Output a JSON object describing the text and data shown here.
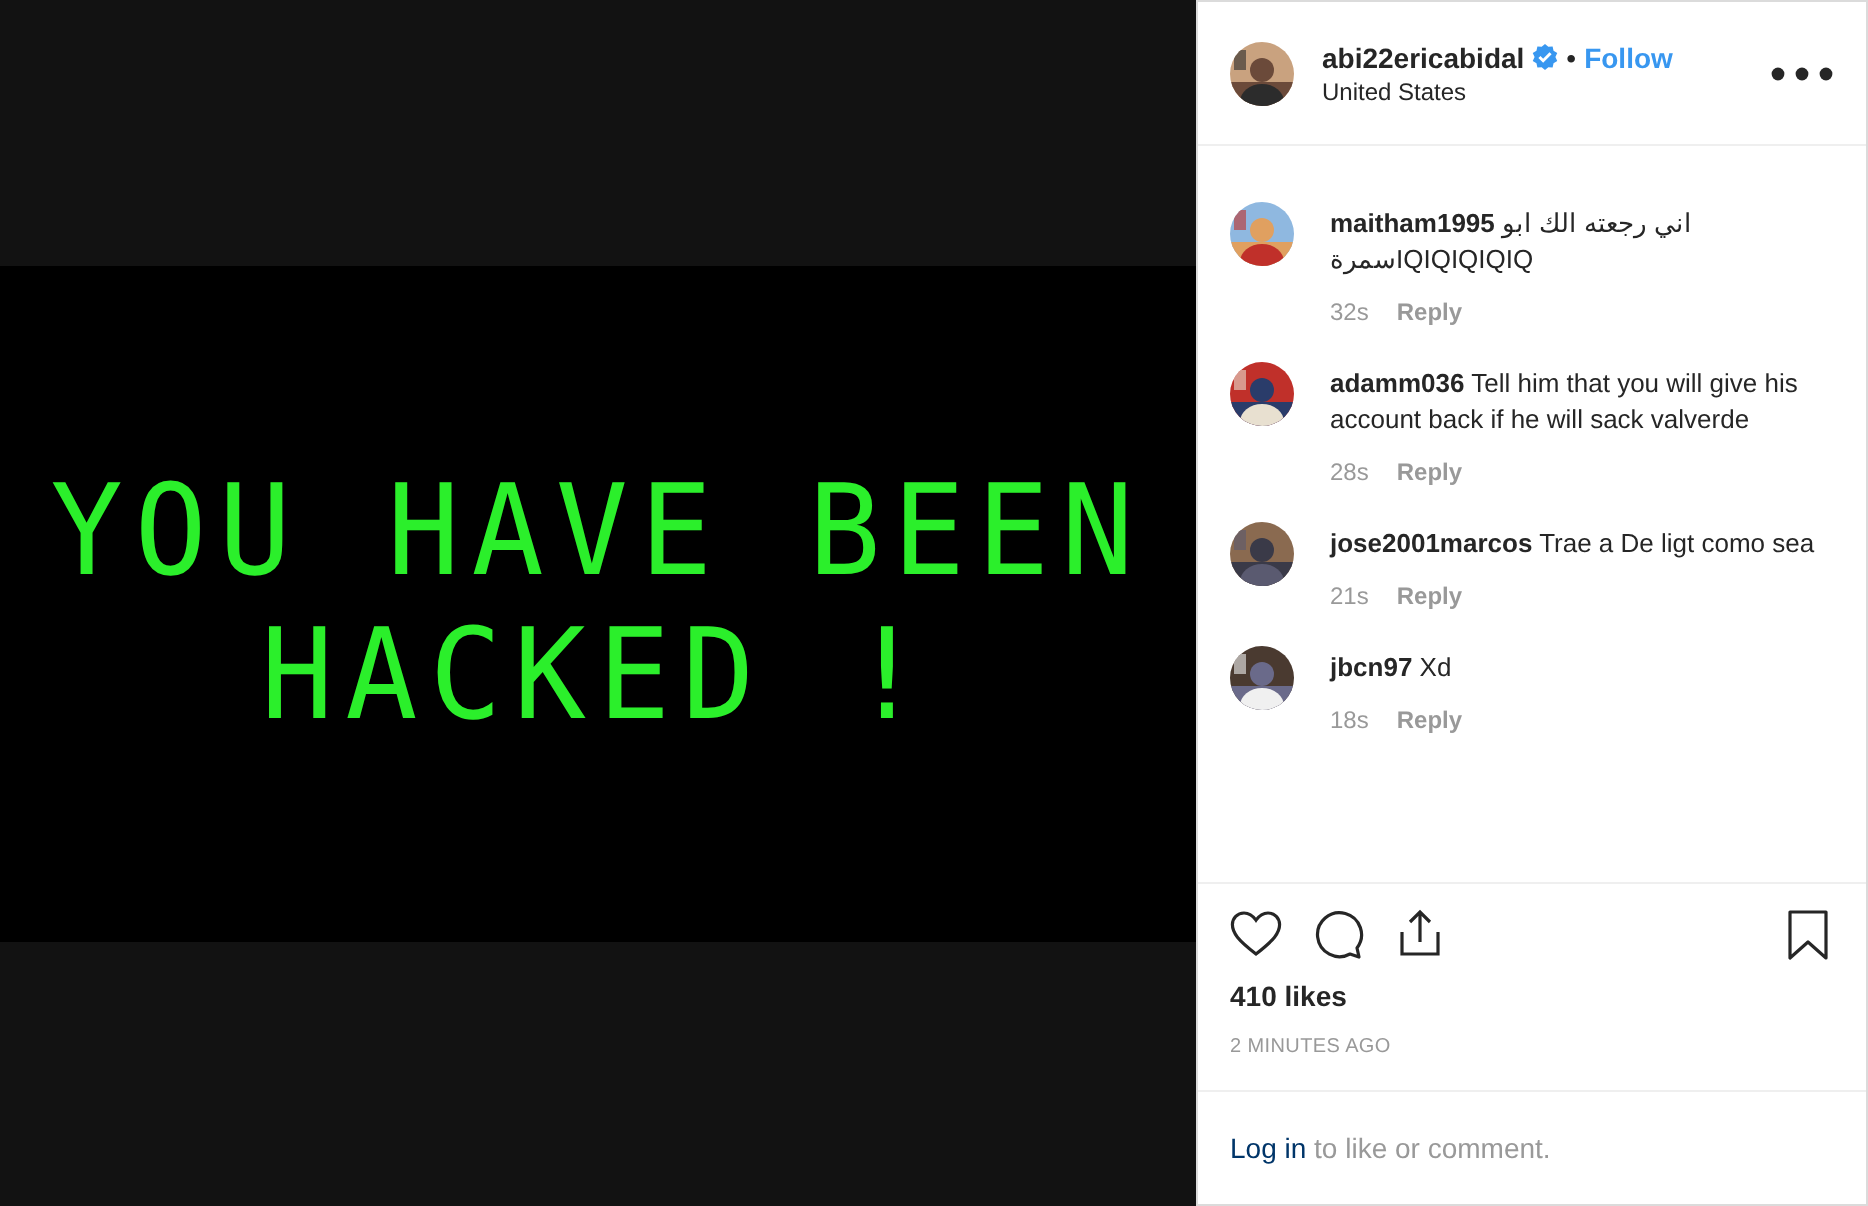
{
  "post_image": {
    "lines": [
      "YOU HAVE BEEN",
      "HACKED !"
    ]
  },
  "header": {
    "username": "abi22ericabidal",
    "verified": true,
    "separator": "•",
    "follow": "Follow",
    "location": "United States"
  },
  "comments": [
    {
      "user": "maitham1995",
      "text": "اني رجعته الك ابو سمرةIQIQIQIQIQ",
      "time": "32s",
      "reply": "Reply"
    },
    {
      "user": "adamm036",
      "text": "Tell him that you will give his account back if he will sack valverde",
      "time": "28s",
      "reply": "Reply"
    },
    {
      "user": "jose2001marcos",
      "text": "Trae a De ligt como sea",
      "time": "21s",
      "reply": "Reply"
    },
    {
      "user": "jbcn97",
      "text": "Xd",
      "time": "18s",
      "reply": "Reply"
    }
  ],
  "likes": "410 likes",
  "posted": "2 MINUTES AGO",
  "login": {
    "link": "Log in",
    "rest": "to like or comment."
  }
}
